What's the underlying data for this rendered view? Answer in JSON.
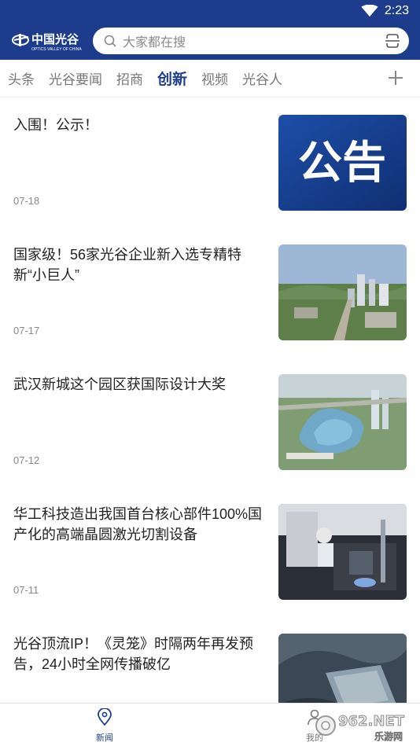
{
  "status_bar": {
    "time": "2:23",
    "wifi_icon": "wifi-icon"
  },
  "header": {
    "logo_text": "中国光谷",
    "logo_subtext": "OPTICS VALLEY OF CHINA",
    "search_placeholder": "大家都在搜",
    "search_icon": "search-icon",
    "scan_icon": "scan-icon",
    "color": "#1d3d8c"
  },
  "tabs": {
    "items": [
      {
        "label": "头条"
      },
      {
        "label": "光谷要闻"
      },
      {
        "label": "招商"
      },
      {
        "label": "创新"
      },
      {
        "label": "视频"
      },
      {
        "label": "光谷人"
      }
    ],
    "active_index": 3,
    "add_icon": "plus-icon"
  },
  "news": [
    {
      "title": "入围！公示！",
      "date": "07-18",
      "thumb_text": "公告",
      "thumb": "announcement-image"
    },
    {
      "title": "国家级！56家光谷企业新入选专精特新“小巨人”",
      "date": "07-17",
      "thumb": "city-aerial-image"
    },
    {
      "title": "武汉新城这个园区获国际设计大奖",
      "date": "07-12",
      "thumb": "park-rendering-image"
    },
    {
      "title": "华工科技造出我国首台核心部件100%国产化的高端晶圆激光切割设备",
      "date": "07-11",
      "thumb": "lab-equipment-image"
    },
    {
      "title": "光谷顶流IP！《灵笼》时隔两年再发预告，24小时全网传播破亿",
      "date": "",
      "thumb": "animation-still-image"
    }
  ],
  "bottom_nav": {
    "items": [
      {
        "label": "新闻",
        "icon": "location-pin-icon",
        "active": true
      },
      {
        "label": "我的",
        "icon": "user-icon",
        "active": false
      }
    ]
  },
  "watermark": {
    "text": "962.NET",
    "subtext": "乐游网"
  }
}
